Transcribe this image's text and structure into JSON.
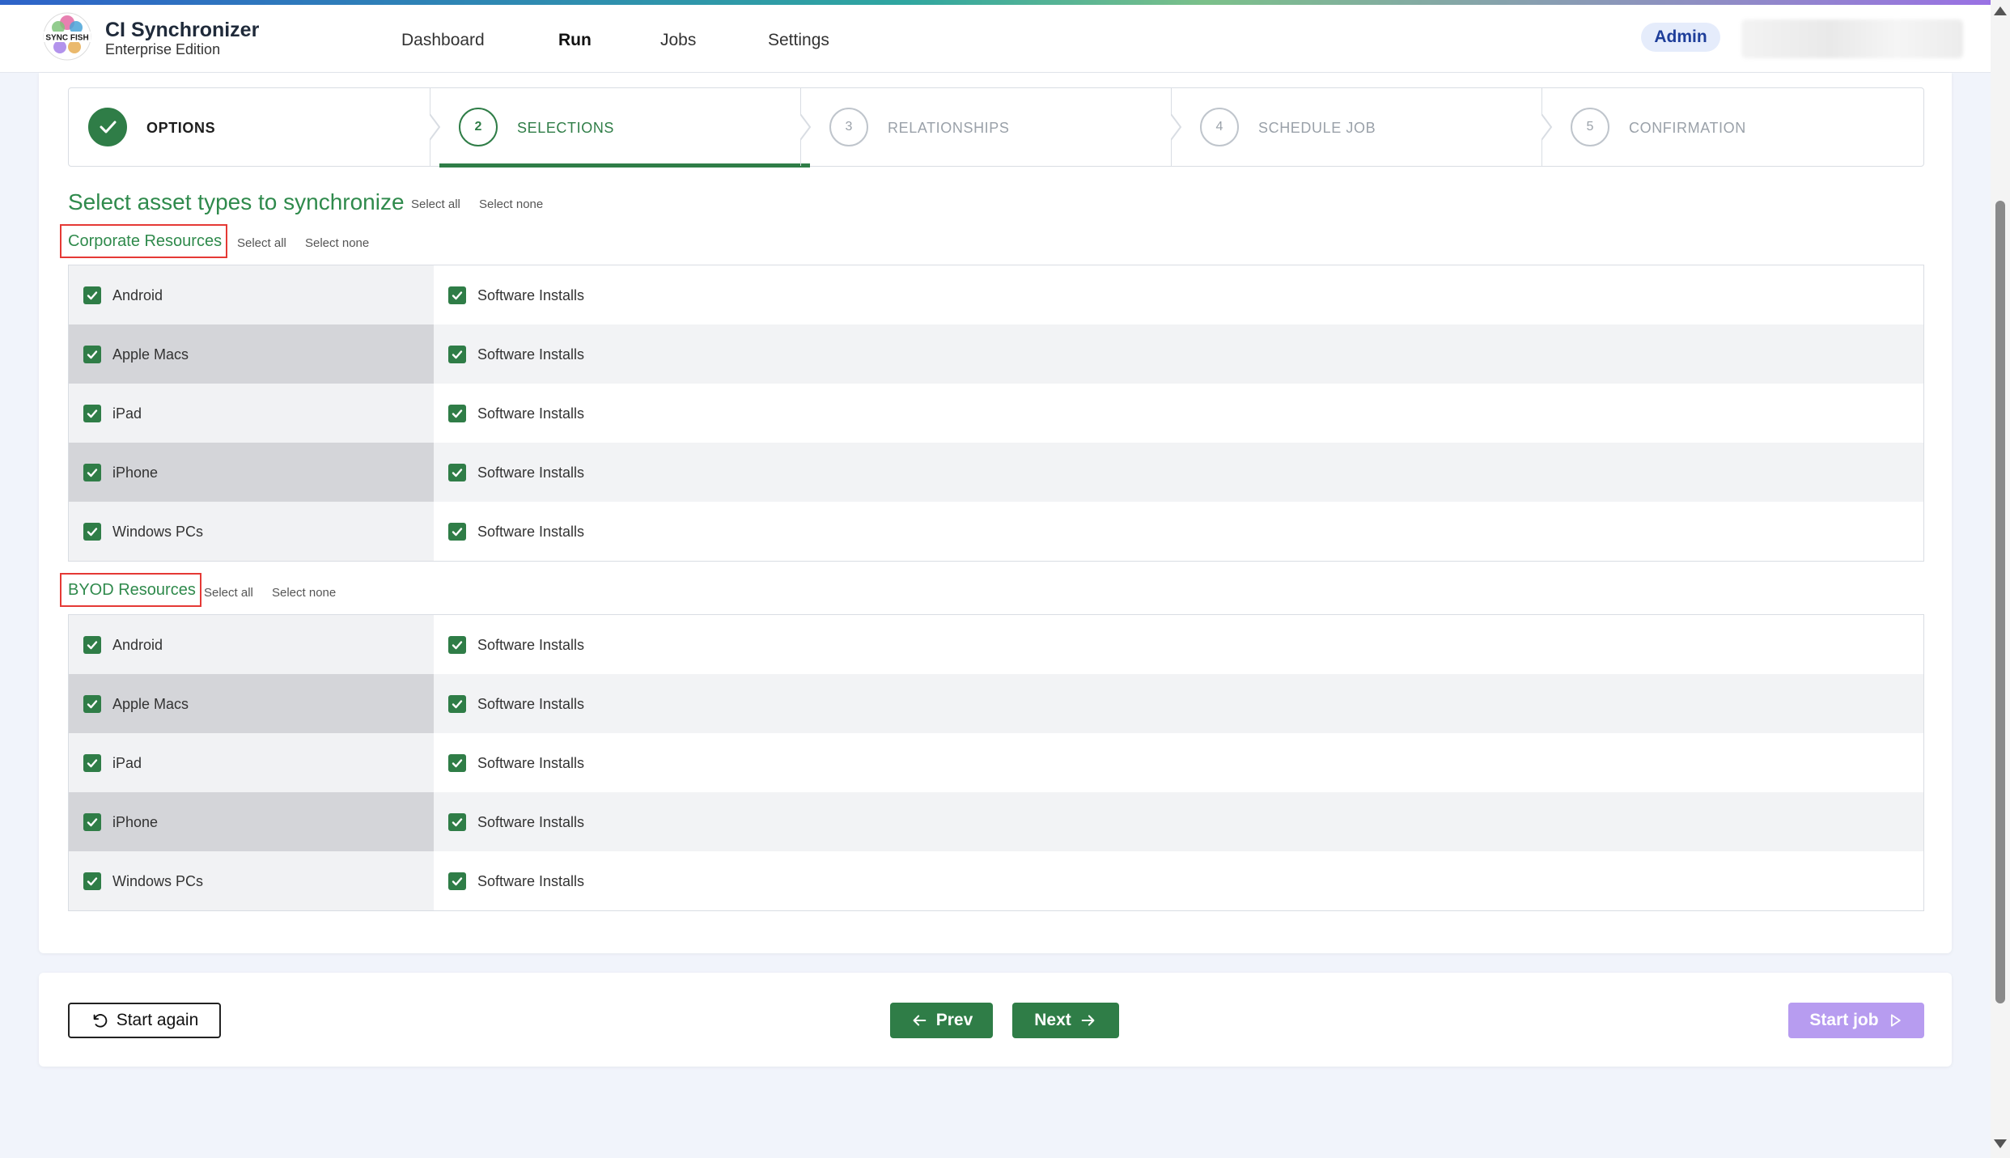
{
  "app": {
    "title": "CI Synchronizer",
    "edition": "Enterprise Edition",
    "logo_text": "SYNC FISH"
  },
  "nav": {
    "items": [
      {
        "label": "Dashboard",
        "active": false
      },
      {
        "label": "Run",
        "active": true
      },
      {
        "label": "Jobs",
        "active": false
      },
      {
        "label": "Settings",
        "active": false
      }
    ],
    "user_badge": "Admin"
  },
  "stepper": {
    "steps": [
      {
        "number": "",
        "label": "OPTIONS",
        "state": "done"
      },
      {
        "number": "2",
        "label": "SELECTIONS",
        "state": "active"
      },
      {
        "number": "3",
        "label": "RELATIONSHIPS",
        "state": "pending"
      },
      {
        "number": "4",
        "label": "SCHEDULE JOB",
        "state": "pending"
      },
      {
        "number": "5",
        "label": "CONFIRMATION",
        "state": "pending"
      }
    ]
  },
  "selection": {
    "title": "Select asset types to synchronize",
    "select_all": "Select all",
    "select_none": "Select none",
    "groups": [
      {
        "title": "Corporate Resources",
        "select_all": "Select all",
        "select_none": "Select none",
        "rows": [
          {
            "asset": "Android",
            "asset_checked": true,
            "sub": "Software Installs",
            "sub_checked": true
          },
          {
            "asset": "Apple Macs",
            "asset_checked": true,
            "sub": "Software Installs",
            "sub_checked": true
          },
          {
            "asset": "iPad",
            "asset_checked": true,
            "sub": "Software Installs",
            "sub_checked": true
          },
          {
            "asset": "iPhone",
            "asset_checked": true,
            "sub": "Software Installs",
            "sub_checked": true
          },
          {
            "asset": "Windows PCs",
            "asset_checked": true,
            "sub": "Software Installs",
            "sub_checked": true
          }
        ]
      },
      {
        "title": "BYOD Resources",
        "select_all": "Select all",
        "select_none": "Select none",
        "rows": [
          {
            "asset": "Android",
            "asset_checked": true,
            "sub": "Software Installs",
            "sub_checked": true
          },
          {
            "asset": "Apple Macs",
            "asset_checked": true,
            "sub": "Software Installs",
            "sub_checked": true
          },
          {
            "asset": "iPad",
            "asset_checked": true,
            "sub": "Software Installs",
            "sub_checked": true
          },
          {
            "asset": "iPhone",
            "asset_checked": true,
            "sub": "Software Installs",
            "sub_checked": true
          },
          {
            "asset": "Windows PCs",
            "asset_checked": true,
            "sub": "Software Installs",
            "sub_checked": true
          }
        ]
      }
    ]
  },
  "footer": {
    "start_again": "Start again",
    "prev": "Prev",
    "next": "Next",
    "start_job": "Start job"
  },
  "icons": {
    "check": "check-icon",
    "undo": "undo-icon",
    "arrow_left": "arrow-left-icon",
    "arrow_right": "arrow-right-icon",
    "play": "play-icon"
  },
  "colors": {
    "primary_green": "#2f7d47",
    "title_green": "#2f8a4c",
    "highlight_red": "#e53935",
    "start_job_disabled": "#b79cf0",
    "admin_text": "#1e3e9a"
  }
}
